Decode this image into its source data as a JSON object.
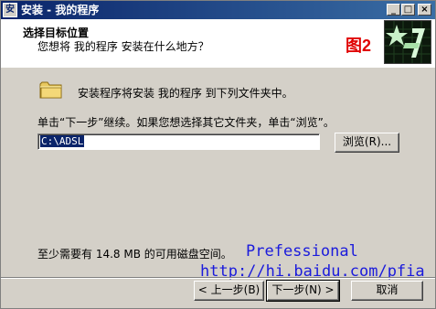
{
  "window": {
    "title": "安装 - 我的程序",
    "icon_label": "安",
    "controls": {
      "minimize": "_",
      "maximize": "□",
      "close": "×"
    }
  },
  "header": {
    "title": "选择目标位置",
    "subtitle": "您想将 我的程序 安装在什么地方？",
    "figure_label": "图2"
  },
  "body": {
    "install_message": "安装程序将安装 我的程序 到下列文件夹中。",
    "instruction": "单击“下一步”继续。如果您想选择其它文件夹，单击“浏览”。",
    "path_value": "C:\\ADSL",
    "browse_label": "浏览(R)...",
    "space_required": "至少需要有 14.8 MB 的可用磁盘空间。"
  },
  "watermark": {
    "line1": "Prefessional",
    "line2": "http://hi.baidu.com/pfia"
  },
  "footer": {
    "back_label": "< 上一步(B)",
    "next_label": "下一步(N) >",
    "cancel_label": "取消"
  },
  "colors": {
    "title_bar": "#0a246a",
    "figure_label": "#e00000",
    "watermark": "#1a1adc",
    "selection": "#0a246a"
  },
  "icons": [
    "app-icon",
    "folder-icon",
    "installer-logo-icon",
    "minimize-icon",
    "maximize-icon",
    "close-icon"
  ]
}
